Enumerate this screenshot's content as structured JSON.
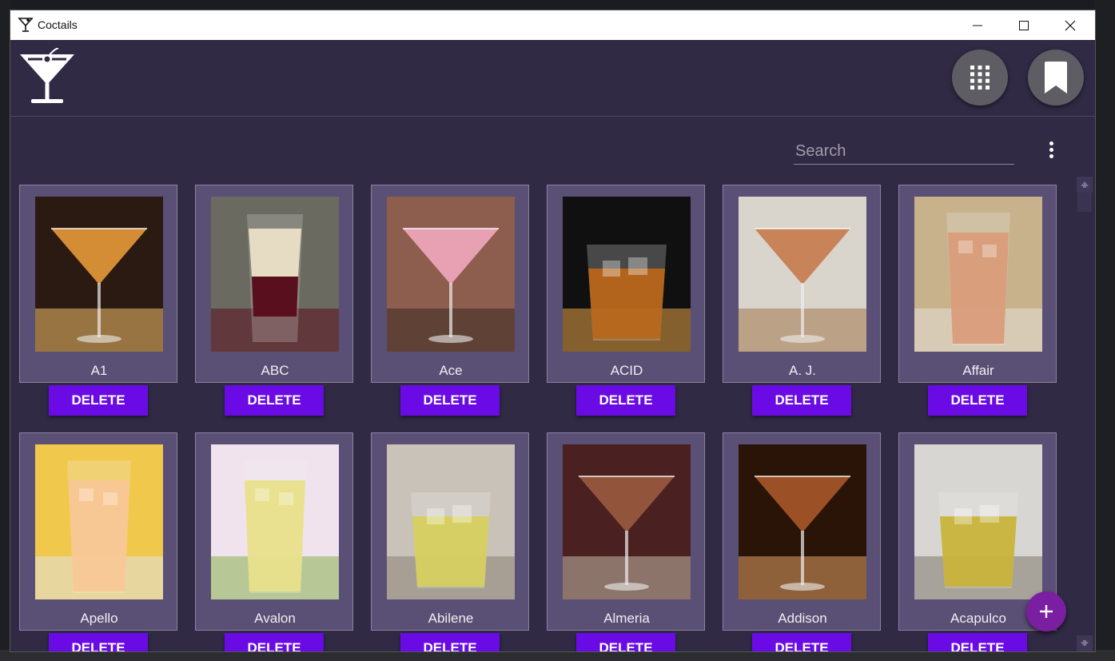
{
  "window": {
    "title": "Coctails"
  },
  "header": {
    "logo_icon": "martini-glass-icon",
    "apps_icon": "grid-icon",
    "bookmark_icon": "bookmark-icon"
  },
  "search": {
    "placeholder": "Search",
    "value": ""
  },
  "actions": {
    "delete_label": "DELETE",
    "add_icon": "plus-icon",
    "more_icon": "more-vertical-icon"
  },
  "colors": {
    "accent": "#6a0be5",
    "fab": "#7b1fa2",
    "card": "#5a4f74",
    "background": "#302a45"
  },
  "cocktails": [
    {
      "name": "A1",
      "palette": [
        "#2a1a12",
        "#e89a3a",
        "#f3c06a"
      ],
      "glass": "martini"
    },
    {
      "name": "ABC",
      "palette": [
        "#6b6a61",
        "#e6dcc4",
        "#5a0f1e"
      ],
      "glass": "shot"
    },
    {
      "name": "Ace",
      "palette": [
        "#8d5d4e",
        "#f2a7bf",
        "#3a2a22"
      ],
      "glass": "martini"
    },
    {
      "name": "ACID",
      "palette": [
        "#101010",
        "#b8661b",
        "#e4a348"
      ],
      "glass": "rocks"
    },
    {
      "name": "A. J.",
      "palette": [
        "#d9d4cc",
        "#c77a4c",
        "#a3774a"
      ],
      "glass": "martini"
    },
    {
      "name": "Affair",
      "palette": [
        "#c7b28b",
        "#d99c7a",
        "#e3e0d8"
      ],
      "glass": "tall"
    },
    {
      "name": "Apello",
      "palette": [
        "#f0c84b",
        "#f7c795",
        "#e0e2e4"
      ],
      "glass": "tall"
    },
    {
      "name": "Avalon",
      "palette": [
        "#f0e3ee",
        "#e8e08a",
        "#88b34e"
      ],
      "glass": "tall"
    },
    {
      "name": "Abilene",
      "palette": [
        "#c9c2b8",
        "#d5cf5f",
        "#8a8374"
      ],
      "glass": "rocks"
    },
    {
      "name": "Almeria",
      "palette": [
        "#4a2020",
        "#9a5a3e",
        "#c2b9a8"
      ],
      "glass": "martini"
    },
    {
      "name": "Addison",
      "palette": [
        "#2a1408",
        "#a8562a",
        "#e1a066"
      ],
      "glass": "martini"
    },
    {
      "name": "Acapulco",
      "palette": [
        "#d8d6d2",
        "#c8b33a",
        "#7f7a6e"
      ],
      "glass": "rocks"
    }
  ]
}
